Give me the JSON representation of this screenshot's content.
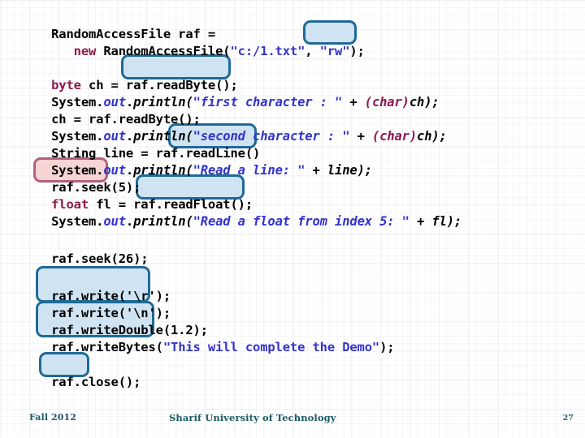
{
  "slide": {
    "footer": {
      "term": "Fall 2012",
      "organization": "Sharif University of Technology",
      "page_number": "27"
    },
    "colors": {
      "highlight_blue_fill": "#cfe3f2",
      "highlight_blue_border": "#1f6a96",
      "highlight_pink_fill": "#f6d4d4",
      "highlight_pink_border": "#b4607e",
      "keyword": "#8c1a4b",
      "string": "#3333cc",
      "code_text": "#000000",
      "footer_text": "#1f5b63",
      "background": "#ffffff"
    }
  },
  "code": {
    "lines": [
      {
        "id": "line-1",
        "text": "RandomAccessFile raf =",
        "segments": [
          {
            "t": "RandomAccessFile raf =",
            "c": "plain"
          }
        ]
      },
      {
        "id": "line-2",
        "text": "   new RandomAccessFile(\"c:/1.txt\", \"rw\");",
        "segments": [
          {
            "t": "   ",
            "c": "plain"
          },
          {
            "t": "new",
            "c": "kw"
          },
          {
            "t": " RandomAccessFile(",
            "c": "plain"
          },
          {
            "t": "\"c:/1.txt\"",
            "c": "strp"
          },
          {
            "t": ", ",
            "c": "plain"
          },
          {
            "t": "\"rw\"",
            "c": "strp"
          },
          {
            "t": ");",
            "c": "plain"
          }
        ]
      },
      {
        "id": "line-3",
        "text": "byte ch = raf.readByte();",
        "segments": [
          {
            "t": "byte",
            "c": "kw"
          },
          {
            "t": " ch = raf.readByte();",
            "c": "plain"
          }
        ]
      },
      {
        "id": "line-4",
        "text": "System.out.println(\"first character : \" + (char)ch);",
        "segments": [
          {
            "t": "System.",
            "c": "plain"
          },
          {
            "t": "out",
            "c": "var"
          },
          {
            "t": ".",
            "c": "plain"
          },
          {
            "t": "println(",
            "c": "it"
          },
          {
            "t": "\"first character : \"",
            "c": "str"
          },
          {
            "t": " + ",
            "c": "it"
          },
          {
            "t": "(char)",
            "c": "kw-it"
          },
          {
            "t": "ch);",
            "c": "it"
          }
        ]
      },
      {
        "id": "line-5",
        "text": "ch = raf.readByte();",
        "segments": [
          {
            "t": "ch = raf.readByte();",
            "c": "plain"
          }
        ]
      },
      {
        "id": "line-6",
        "text": "System.out.println(\"second character : \" + (char)ch);",
        "segments": [
          {
            "t": "System.",
            "c": "plain"
          },
          {
            "t": "out",
            "c": "var"
          },
          {
            "t": ".",
            "c": "plain"
          },
          {
            "t": "println(",
            "c": "it"
          },
          {
            "t": "\"second character : \"",
            "c": "str"
          },
          {
            "t": " + ",
            "c": "it"
          },
          {
            "t": "(char)",
            "c": "kw-it"
          },
          {
            "t": "ch);",
            "c": "it"
          }
        ]
      },
      {
        "id": "line-7",
        "text": "String line = raf.readLine()",
        "segments": [
          {
            "t": "String line = raf.readLine()",
            "c": "plain"
          }
        ]
      },
      {
        "id": "line-8",
        "text": "System.out.println(\"Read a line: \" + line);",
        "segments": [
          {
            "t": "System.",
            "c": "plain"
          },
          {
            "t": "out",
            "c": "var"
          },
          {
            "t": ".",
            "c": "plain"
          },
          {
            "t": "println(",
            "c": "it"
          },
          {
            "t": "\"Read a line: \"",
            "c": "str"
          },
          {
            "t": " + line);",
            "c": "it"
          }
        ]
      },
      {
        "id": "line-9",
        "text": "raf.seek(5);",
        "segments": [
          {
            "t": "raf.seek(5);",
            "c": "plain"
          }
        ]
      },
      {
        "id": "line-10",
        "text": "float fl = raf.readFloat();",
        "segments": [
          {
            "t": "float",
            "c": "kw"
          },
          {
            "t": " fl = raf.readFloat();",
            "c": "plain"
          }
        ]
      },
      {
        "id": "line-11",
        "text": "System.out.println(\"Read a float from index 5: \" + fl);",
        "segments": [
          {
            "t": "System.",
            "c": "plain"
          },
          {
            "t": "out",
            "c": "var"
          },
          {
            "t": ".",
            "c": "plain"
          },
          {
            "t": "println(",
            "c": "it"
          },
          {
            "t": "\"Read a float from index 5: \"",
            "c": "str"
          },
          {
            "t": " + fl);",
            "c": "it"
          }
        ]
      },
      {
        "id": "line-12",
        "text": "raf.seek(26);",
        "segments": [
          {
            "t": "raf.seek(26);",
            "c": "plain"
          }
        ]
      },
      {
        "id": "line-13",
        "text": "raf.write('\\r');",
        "segments": [
          {
            "t": "raf.write('\\r');",
            "c": "plain"
          }
        ]
      },
      {
        "id": "line-14",
        "text": "raf.write('\\n');",
        "segments": [
          {
            "t": "raf.write('\\n');",
            "c": "plain"
          }
        ]
      },
      {
        "id": "line-15",
        "text": "raf.writeDouble(1.2);",
        "segments": [
          {
            "t": "raf.writeDouble(1.2);",
            "c": "plain"
          }
        ]
      },
      {
        "id": "line-16",
        "text": "raf.writeBytes(\"This will complete the Demo\");",
        "segments": [
          {
            "t": "raf.writeBytes(",
            "c": "plain"
          },
          {
            "t": "\"This will complete the Demo\"",
            "c": "strp"
          },
          {
            "t": ");",
            "c": "plain"
          }
        ]
      },
      {
        "id": "line-17",
        "text": "raf.close();",
        "segments": [
          {
            "t": "raf.close();",
            "c": "plain"
          }
        ]
      }
    ],
    "highlights": [
      {
        "id": "hl-rw",
        "target": "\"rw\"",
        "style": "blue"
      },
      {
        "id": "hl-readbyte",
        "target": ".readByte();",
        "style": "blue"
      },
      {
        "id": "hl-readline",
        "target": "f.readLine()",
        "style": "blue"
      },
      {
        "id": "hl-seek5",
        "target": ".seek(5);",
        "style": "pink"
      },
      {
        "id": "hl-readfloat",
        "target": ".readFloat();",
        "style": "blue"
      },
      {
        "id": "hl-write",
        "target": "write('\\r'); / write('\\n');",
        "style": "blue"
      },
      {
        "id": "hl-writedouble",
        "target": "writeDouble / writeBytes",
        "style": "blue"
      },
      {
        "id": "hl-close",
        "target": "close",
        "style": "blue"
      }
    ]
  }
}
